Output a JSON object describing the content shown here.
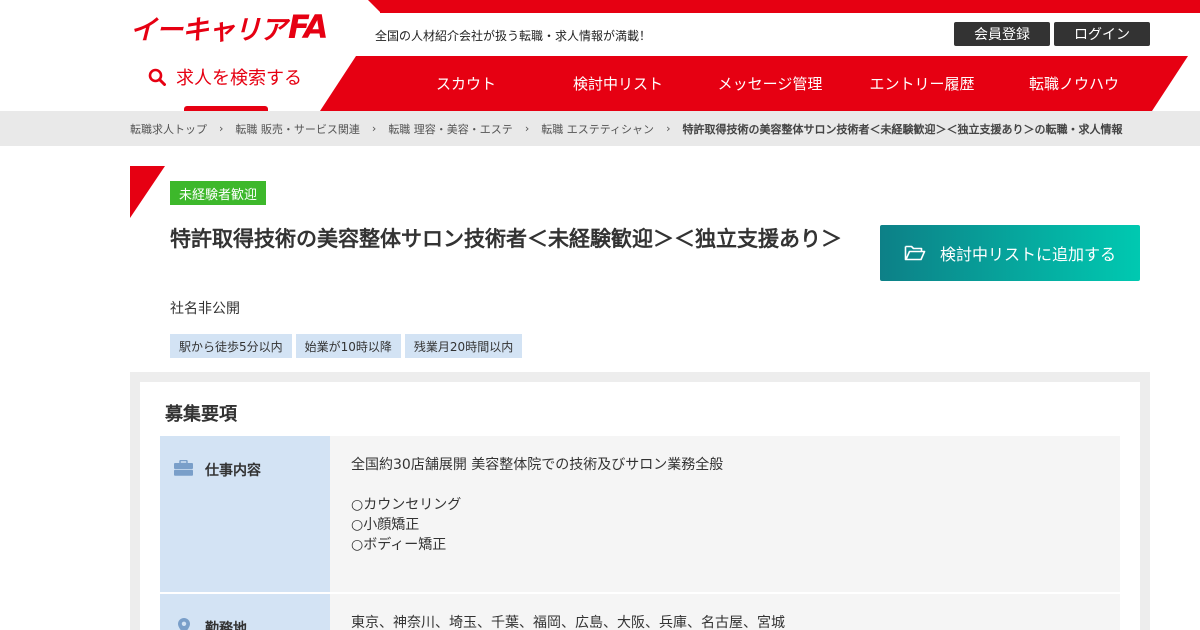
{
  "header": {
    "logo_text": "イーキャリア",
    "logo_fa": "FA",
    "tagline": "全国の人材紹介会社が扱う転職・求人情報が満載！",
    "register_label": "会員登録",
    "login_label": "ログイン",
    "search_label": "求人を検索する",
    "nav": [
      {
        "label": "スカウト"
      },
      {
        "label": "検討中リスト"
      },
      {
        "label": "メッセージ管理"
      },
      {
        "label": "エントリー履歴"
      },
      {
        "label": "転職ノウハウ"
      }
    ]
  },
  "breadcrumb": {
    "items": [
      {
        "label": "転職求人トップ"
      },
      {
        "label": "転職 販売・サービス関連"
      },
      {
        "label": "転職 理容・美容・エステ"
      },
      {
        "label": "転職 エステティシャン"
      }
    ],
    "current": "特許取得技術の美容整体サロン技術者＜未経験歓迎＞＜独立支援あり＞の転職・求人情報",
    "separator": "›"
  },
  "job": {
    "badge": "未経験者歓迎",
    "title": "特許取得技術の美容整体サロン技術者＜未経験歓迎＞＜独立支援あり＞",
    "company": "社名非公開",
    "tags": [
      "駅から徒歩5分以内",
      "始業が10時以降",
      "残業月20時間以内"
    ],
    "add_list_label": "検討中リストに追加する"
  },
  "requirements": {
    "heading": "募集要項",
    "rows": [
      {
        "label": "仕事内容",
        "icon": "briefcase-icon",
        "lines": [
          "全国約30店舗展開 美容整体院での技術及びサロン業務全般",
          "",
          "○カウンセリング",
          "○小顔矯正",
          "○ボディー矯正"
        ]
      },
      {
        "label": "勤務地",
        "icon": "map-pin-icon",
        "lines": [
          "東京、神奈川、埼玉、千葉、福岡、広島、大阪、兵庫、名古屋、宮城"
        ]
      }
    ]
  },
  "colors": {
    "brand_red": "#e60012",
    "badge_green": "#3db82b",
    "tag_blue": "#d3e3f4",
    "button_teal_start": "#0d8087",
    "button_teal_end": "#00c9b1"
  }
}
